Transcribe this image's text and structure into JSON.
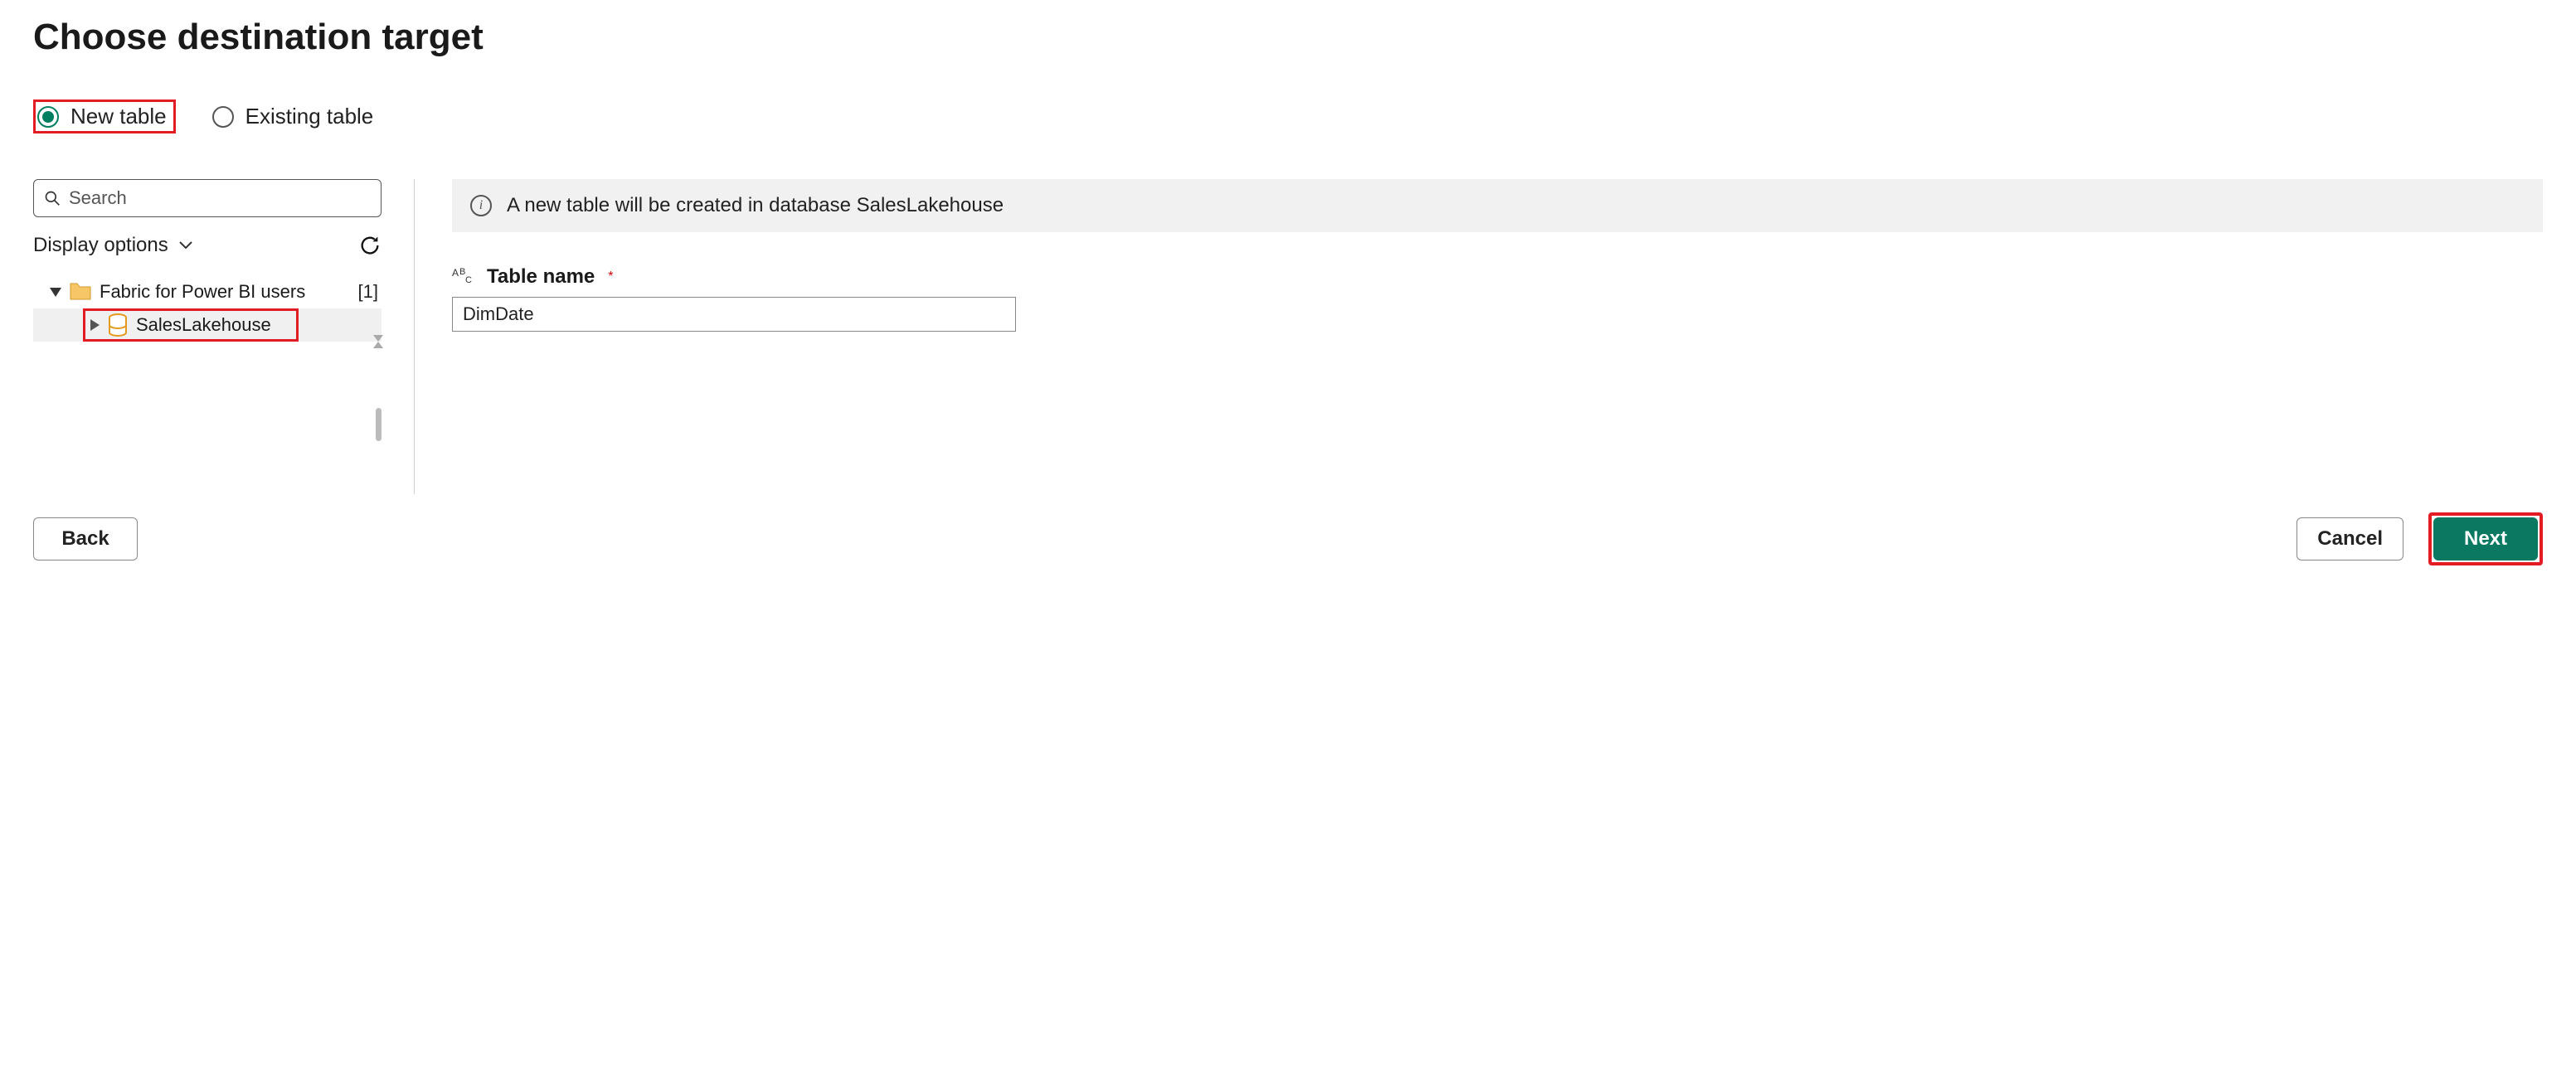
{
  "title": "Choose destination target",
  "radio": {
    "new_table": "New table",
    "existing_table": "Existing table",
    "selected": "new"
  },
  "search": {
    "placeholder": "Search"
  },
  "display_options_label": "Display options",
  "tree": {
    "root": {
      "label": "Fabric for Power BI users",
      "count": "[1]"
    },
    "child": {
      "label": "SalesLakehouse"
    }
  },
  "info_message": "A new table will be created in database SalesLakehouse",
  "table_name": {
    "label": "Table name",
    "value": "DimDate"
  },
  "buttons": {
    "back": "Back",
    "cancel": "Cancel",
    "next": "Next"
  }
}
